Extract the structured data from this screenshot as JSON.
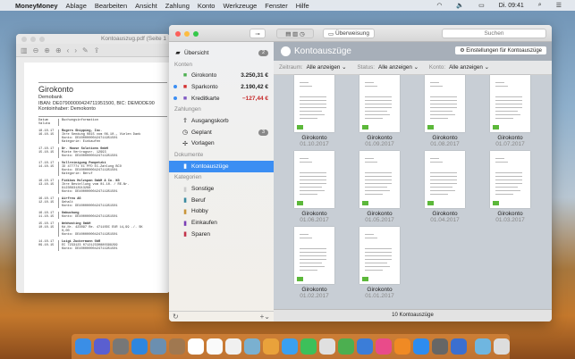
{
  "menubar": {
    "apple": "",
    "app": "MoneyMoney",
    "items": [
      "Ablage",
      "Bearbeiten",
      "Ansicht",
      "Zahlung",
      "Konto",
      "Werkzeuge",
      "Fenster",
      "Hilfe"
    ],
    "clock": "Di. 09:41"
  },
  "preview": {
    "title": "Kontoauszug.pdf (Seite 1",
    "doc_title": "Girokonto",
    "bank": "Demobank",
    "iban": "IBAN: DE07900000424711951500, BIC: DEMODE90",
    "holder": "Kontoinhaber: Demokonto",
    "col_date": "Datum Valuta",
    "col_info": "Buchungsinformation",
    "transactions": [
      {
        "d1": "18.10.17",
        "d2": "16.10.15",
        "title": "Rogers Shipping, Inc.",
        "lines": [
          "Ihre Sendung 0815 vom 06.10., Vielen Dank",
          "Konto: DE40000000424711951501",
          "Kategorie: Einkaufen"
        ]
      },
      {
        "d1": "17.10.17",
        "d2": "15.10.15",
        "title": "Dr. House Solutions GmbH",
        "lines": [
          "Miete Vertragsnr. 12993",
          "Konto: DE40000000424711951501"
        ]
      },
      {
        "d1": "17.10.17",
        "d2": "14.10.15",
        "title": "Vollreinigung Pompetzki",
        "lines": [
          "ID 477771 EC PFD EC-Zahlung BCO",
          "Konto: DE40000000424711951501",
          "Kategorie: Beruf"
        ]
      },
      {
        "d1": "16.10.17",
        "d2": "13.10.15",
        "title": "Fidibus Holzspan GmbH & Co. KG",
        "lines": [
          "Ihre Bestellung vom 01.10. / RE-Nr.",
          "912309312913298",
          "Konto: DE40000000424711951501"
        ]
      },
      {
        "d1": "16.10.17",
        "d2": "12.10.15",
        "title": "Airfreu AG",
        "lines": [
          "Gehalt",
          "Konto: DE40000000424711951501"
        ]
      },
      {
        "d1": "16.10.17",
        "d2": "11.10.15",
        "title": "Umbuchung",
        "lines": [
          "Konto: DE40000000424711951501"
        ]
      },
      {
        "d1": "15.10.17",
        "d2": "10.10.15",
        "title": "Webhosting GmbH",
        "lines": [
          "Kd.Nr. 423097 Re. 47110DC EUR 14,99 ./. SK",
          "0,00",
          "Konto: DE40000000424711951501"
        ]
      },
      {
        "d1": "14.10.17",
        "d2": "09.10.15",
        "title": "Luigi Zuckermann GbR",
        "lines": [
          "EC 7233123 071212330880399299",
          "Konto: DE40000000424711951501"
        ]
      }
    ]
  },
  "toolbar": {
    "transfer_label": "Überweisung",
    "search_placeholder": "Suchen"
  },
  "sidebar": {
    "overview": {
      "label": "Übersicht",
      "badge": "2"
    },
    "accounts_header": "Konten",
    "accounts": [
      {
        "label": "Girokonto",
        "amount": "3.250,31 €",
        "color": "#222",
        "icon_color": "#4caf50",
        "dot": false
      },
      {
        "label": "Sparkonto",
        "amount": "2.190,42 €",
        "color": "#222",
        "icon_color": "#d32f2f",
        "dot": true
      },
      {
        "label": "Kreditkarte",
        "amount": "−127,44 €",
        "color": "#c62828",
        "icon_color": "#7e57c2",
        "dot": true
      }
    ],
    "payments_header": "Zahlungen",
    "payments": [
      {
        "label": "Ausgangskorb",
        "icon": "⇪",
        "badge": ""
      },
      {
        "label": "Geplant",
        "icon": "◷",
        "badge": "3"
      },
      {
        "label": "Vorlagen",
        "icon": "✢",
        "badge": ""
      }
    ],
    "documents_header": "Dokumente",
    "documents": [
      {
        "label": "Kontoauszüge"
      }
    ],
    "categories_header": "Kategorien",
    "categories": [
      {
        "label": "Sonstige",
        "color": "#ccc"
      },
      {
        "label": "Beruf",
        "color": "#3a8aa0"
      },
      {
        "label": "Hobby",
        "color": "#c8953a"
      },
      {
        "label": "Einkaufen",
        "color": "#7b3fb5"
      },
      {
        "label": "Sparen",
        "color": "#c2334a"
      }
    ]
  },
  "content": {
    "title": "Kontoauszüge",
    "settings_label": "Einstellungen für Kontoauszüge",
    "filters": [
      {
        "label": "Zeitraum:",
        "value": "Alle anzeigen ⌄"
      },
      {
        "label": "Status:",
        "value": "Alle anzeigen ⌄"
      },
      {
        "label": "Konto:",
        "value": "Alle anzeigen ⌄"
      }
    ],
    "statements": [
      {
        "name": "Girokonto",
        "date": "01.10.2017"
      },
      {
        "name": "Girokonto",
        "date": "01.09.2017"
      },
      {
        "name": "Girokonto",
        "date": "01.08.2017"
      },
      {
        "name": "Girokonto",
        "date": "01.07.2017"
      },
      {
        "name": "Girokonto",
        "date": "01.06.2017"
      },
      {
        "name": "Girokonto",
        "date": "01.05.2017"
      },
      {
        "name": "Girokonto",
        "date": "01.04.2017"
      },
      {
        "name": "Girokonto",
        "date": "01.03.2017"
      },
      {
        "name": "Girokonto",
        "date": "01.02.2017"
      },
      {
        "name": "Girokonto",
        "date": "01.01.2017"
      }
    ],
    "footer": "10 Kontoauszüge"
  },
  "dock": {
    "apps": [
      "finder",
      "siri",
      "launchpad",
      "safari",
      "mail",
      "contacts",
      "calendar",
      "notes",
      "reminders",
      "maps",
      "photos",
      "messages",
      "facetime",
      "pages",
      "numbers",
      "keynote",
      "itunes",
      "ibooks",
      "app-store",
      "system-preferences",
      "moneymoney",
      "downloads",
      "trash"
    ],
    "calendar_day": "17",
    "badge": "2"
  }
}
